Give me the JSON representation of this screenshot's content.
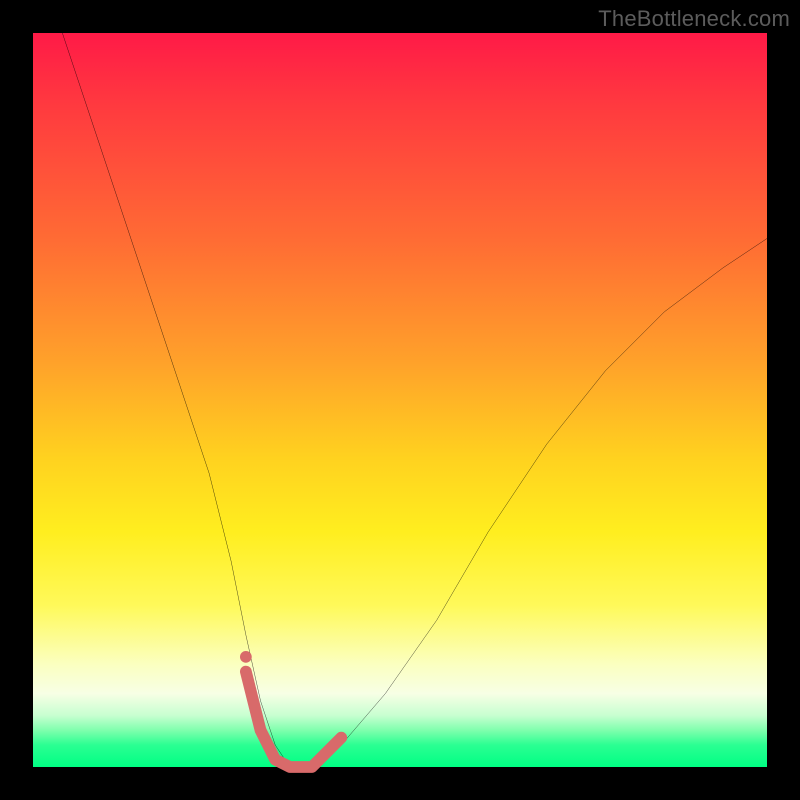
{
  "watermark": "TheBottleneck.com",
  "chart_data": {
    "type": "line",
    "title": "",
    "xlabel": "",
    "ylabel": "",
    "xlim": [
      0,
      100
    ],
    "ylim": [
      0,
      100
    ],
    "grid": false,
    "legend": false,
    "background_gradient": {
      "stops": [
        {
          "pos": 0,
          "color": "#ff1a47"
        },
        {
          "pos": 10,
          "color": "#ff3a3f"
        },
        {
          "pos": 28,
          "color": "#ff6b34"
        },
        {
          "pos": 45,
          "color": "#ffa22a"
        },
        {
          "pos": 58,
          "color": "#ffd21f"
        },
        {
          "pos": 68,
          "color": "#ffee1f"
        },
        {
          "pos": 78,
          "color": "#fff95a"
        },
        {
          "pos": 86,
          "color": "#fbffc0"
        },
        {
          "pos": 90,
          "color": "#f7ffe5"
        },
        {
          "pos": 93,
          "color": "#c7ffd0"
        },
        {
          "pos": 95,
          "color": "#7fffad"
        },
        {
          "pos": 97,
          "color": "#2bff92"
        },
        {
          "pos": 100,
          "color": "#00ff84"
        }
      ]
    },
    "series": [
      {
        "name": "bottleneck-curve",
        "color": "#000000",
        "stroke_width": 2,
        "x": [
          4,
          8,
          12,
          16,
          20,
          24,
          27,
          29,
          31,
          33,
          35,
          38,
          42,
          48,
          55,
          62,
          70,
          78,
          86,
          94,
          100
        ],
        "y": [
          100,
          88,
          76,
          64,
          52,
          40,
          28,
          18,
          9,
          3,
          0,
          0,
          3,
          10,
          20,
          32,
          44,
          54,
          62,
          68,
          72
        ]
      },
      {
        "name": "highlight-band",
        "color": "#d86a6a",
        "stroke_width": 10,
        "x": [
          29,
          31,
          33,
          35,
          38,
          42
        ],
        "y": [
          13,
          5,
          1,
          0,
          0,
          4
        ]
      }
    ],
    "annotations": [
      {
        "name": "highlight-dot",
        "x": 29,
        "y": 15,
        "color": "#d86a6a",
        "r": 5
      }
    ]
  }
}
